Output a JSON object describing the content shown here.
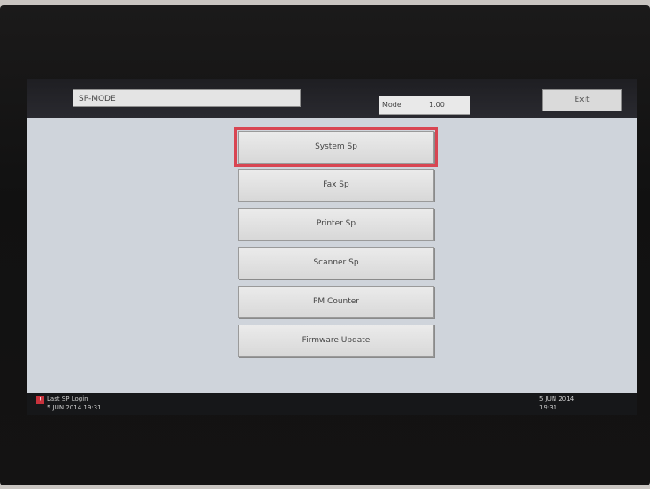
{
  "header": {
    "sp_field": "SP-MODE",
    "mode_label": "Mode",
    "mode_value": "1.00",
    "exit_label": "Exit"
  },
  "menu": {
    "items": [
      {
        "label": "System Sp",
        "selected": true
      },
      {
        "label": "Fax Sp",
        "selected": false
      },
      {
        "label": "Printer Sp",
        "selected": false
      },
      {
        "label": "Scanner Sp",
        "selected": false
      },
      {
        "label": "PM Counter",
        "selected": false
      },
      {
        "label": "Firmware Update",
        "selected": false
      }
    ]
  },
  "status": {
    "warning_icon": "alert-icon",
    "line1": "Last SP Login",
    "line2": "5 JUN 2014 19:31",
    "date": "5 JUN 2014",
    "time": "19:31"
  },
  "colors": {
    "selected_outline": "#d84552"
  }
}
